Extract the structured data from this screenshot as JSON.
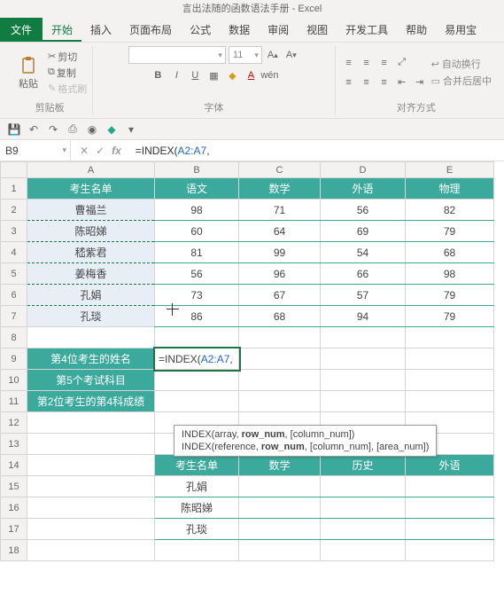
{
  "title": "言出法随的函数语法手册 - Excel",
  "tabs": {
    "file": "文件",
    "home": "开始",
    "insert": "插入",
    "layout": "页面布局",
    "formulas": "公式",
    "data": "数据",
    "review": "审阅",
    "view": "视图",
    "dev": "开发工具",
    "help": "帮助",
    "yyb": "易用宝"
  },
  "ribbon": {
    "clipboard": {
      "title": "剪贴板",
      "paste": "粘贴",
      "cut": "剪切",
      "copy": "复制",
      "painter": "格式刷"
    },
    "font": {
      "title": "字体",
      "nameph": "",
      "sizeph": "11"
    },
    "align": {
      "title": "对齐方式",
      "wrap": "自动换行",
      "merge": "合并后居中"
    }
  },
  "namebox": "B9",
  "formula": "=INDEX(A2:A7,",
  "formula_prefix": "=INDEX(",
  "formula_ref": "A2:A7",
  "formula_suffix": ",",
  "headers": {
    "a": "考生名单",
    "b": "语文",
    "c": "数学",
    "d": "外语",
    "e": "物理"
  },
  "rows": [
    {
      "name": "曹福兰",
      "b": "98",
      "c": "71",
      "d": "56",
      "e": "82"
    },
    {
      "name": "陈昭娣",
      "b": "60",
      "c": "64",
      "d": "69",
      "e": "79"
    },
    {
      "name": "嵇紫君",
      "b": "81",
      "c": "99",
      "d": "54",
      "e": "68"
    },
    {
      "name": "姜梅香",
      "b": "56",
      "c": "96",
      "d": "66",
      "e": "98"
    },
    {
      "name": "孔娟",
      "b": "73",
      "c": "67",
      "d": "57",
      "e": "79"
    },
    {
      "name": "孔琰",
      "b": "86",
      "c": "68",
      "d": "94",
      "e": "79"
    }
  ],
  "labels": {
    "l9": "第4位考生的姓名",
    "l10": "第5个考试科目",
    "l11": "第2位考生的第4科成绩"
  },
  "tooltip": {
    "line1a": "INDEX(array, ",
    "line1b": "row_num",
    "line1c": ", [column_num])",
    "line2a": "INDEX(reference, ",
    "line2b": "row_num",
    "line2c": ", [column_num], [area_num])"
  },
  "headers2": {
    "a": "考生名单",
    "c": "数学",
    "d": "历史",
    "e": "外语"
  },
  "names2": {
    "r15": "孔娟",
    "r16": "陈昭娣",
    "r17": "孔琰"
  },
  "cols": [
    "A",
    "B",
    "C",
    "D",
    "E"
  ]
}
